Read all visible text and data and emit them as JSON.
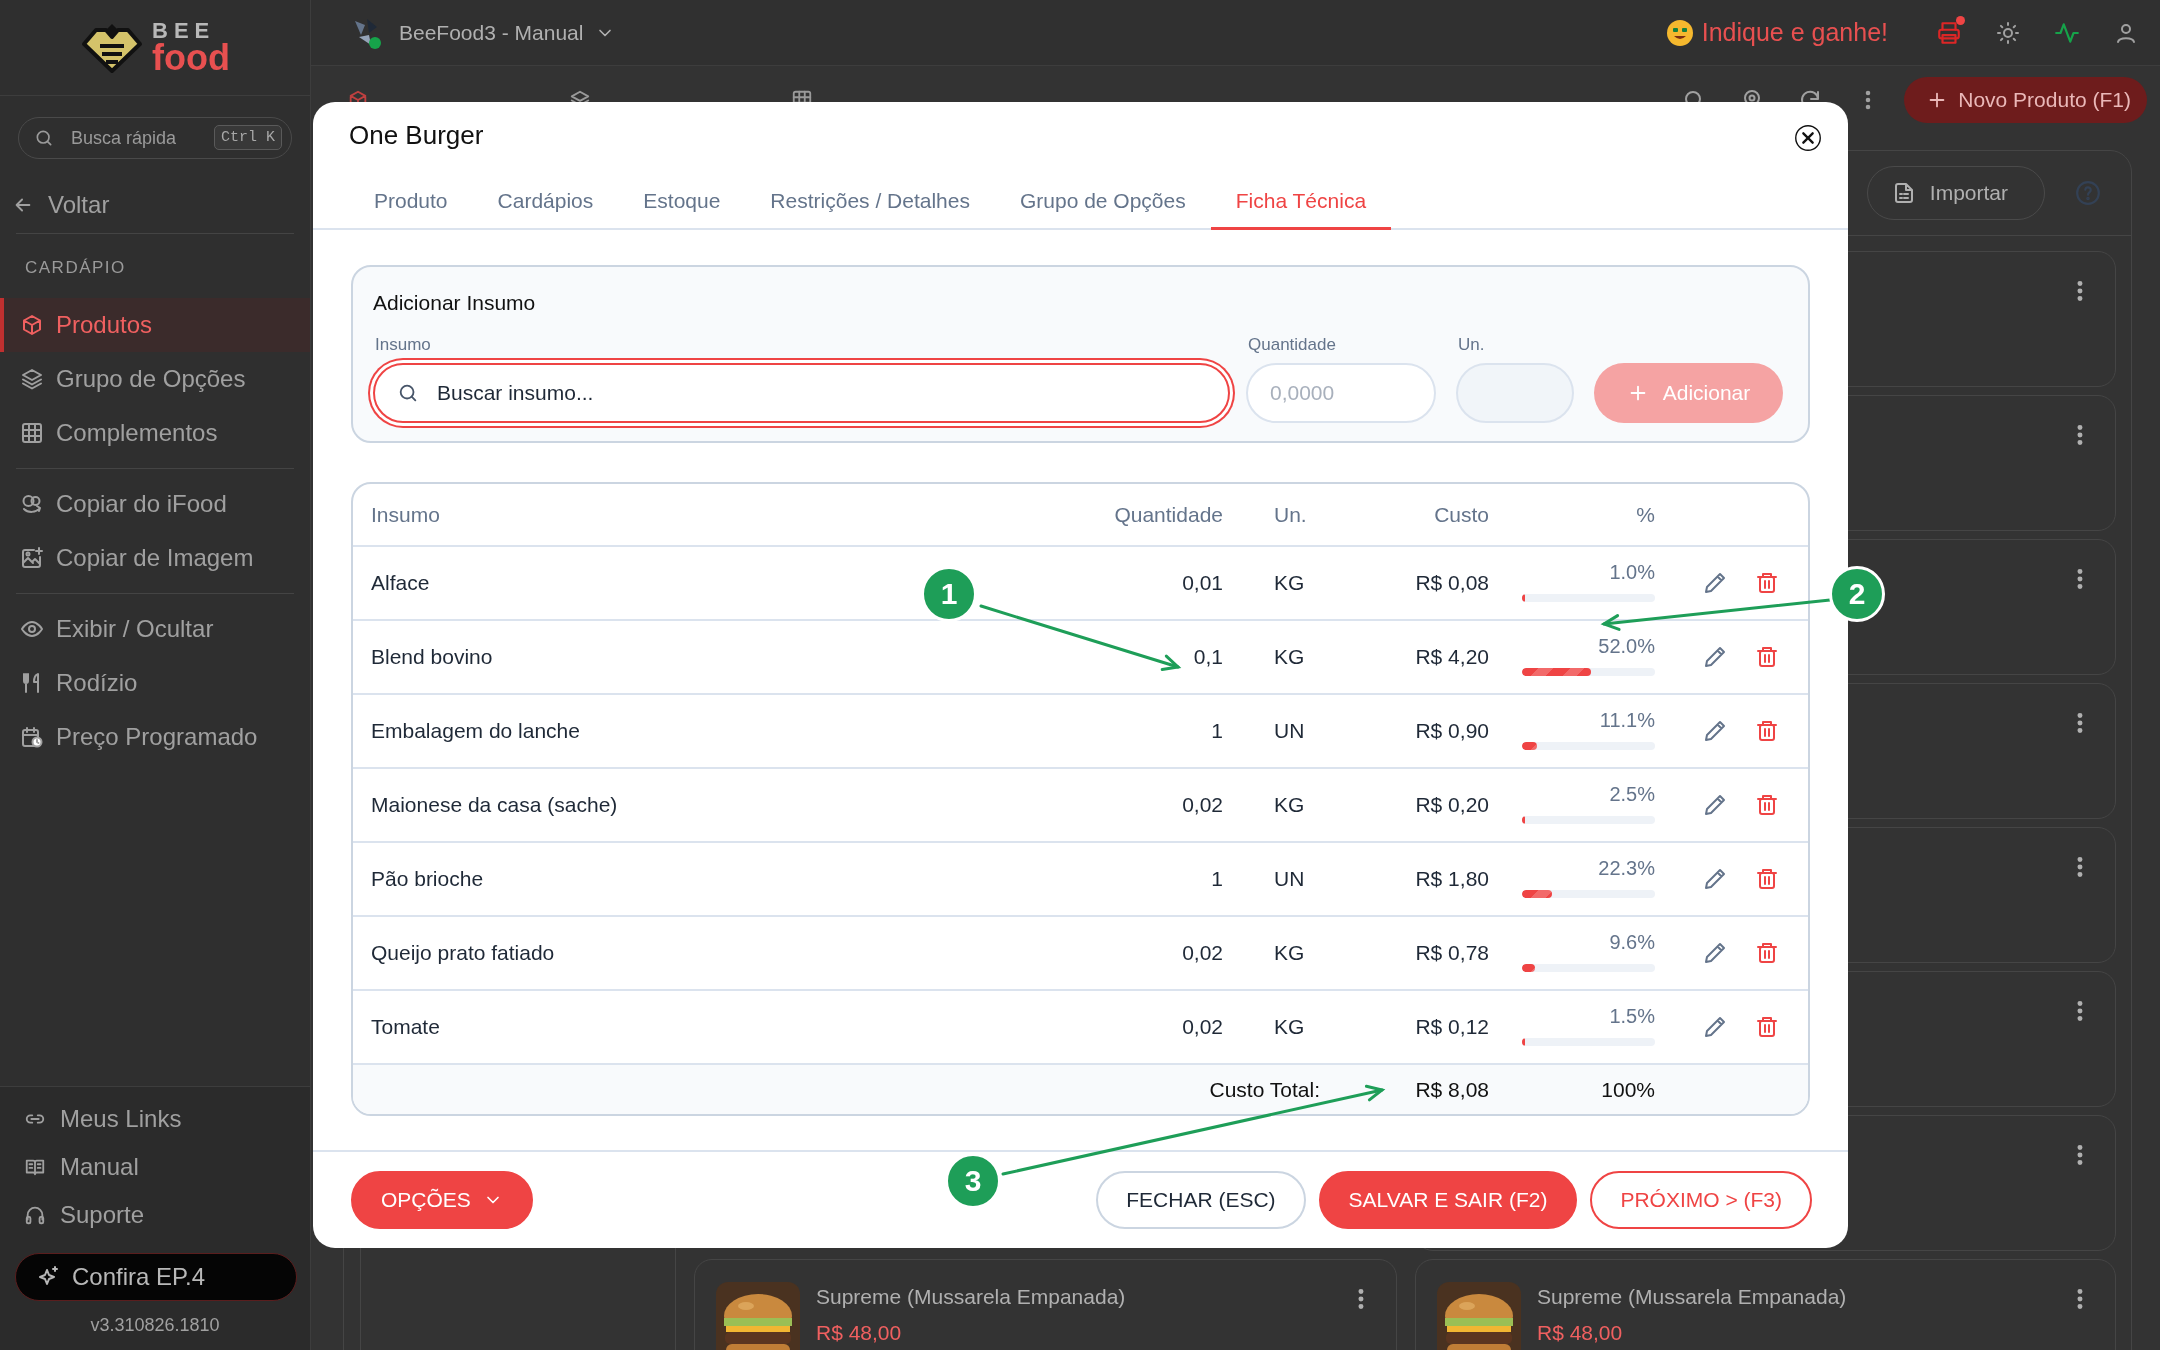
{
  "logo": {
    "line_1": "BEE",
    "line_2": "food"
  },
  "sidebar": {
    "search": {
      "placeholder": "Busca rápida",
      "shortcut": "Ctrl K"
    },
    "back": "Voltar",
    "section": "CARDÁPIO",
    "groups": [
      {
        "items": [
          {
            "label": "Produtos",
            "selected": true
          },
          {
            "label": "Grupo de Opções",
            "selected": false
          },
          {
            "label": "Complementos",
            "selected": false
          }
        ]
      },
      {
        "items": [
          {
            "label": "Copiar do iFood",
            "selected": false
          },
          {
            "label": "Copiar de Imagem",
            "selected": false
          }
        ]
      },
      {
        "items": [
          {
            "label": "Exibir / Ocultar",
            "selected": false
          },
          {
            "label": "Rodízio",
            "selected": false
          },
          {
            "label": "Preço Programado",
            "selected": false
          }
        ]
      }
    ],
    "links": [
      "Meus Links",
      "Manual",
      "Suporte"
    ],
    "promo": "Confira EP.4",
    "version": "v3.310826.1810"
  },
  "top_bar": {
    "workspace": "BeeFood3 - Manual",
    "referral": "Indique e ganhe!"
  },
  "page": {
    "new_button": "Novo Produto (F1)",
    "import_button": "Importar",
    "cards": [
      {
        "kind": "covered"
      },
      {
        "kind": "covered"
      },
      {
        "kind": "covered"
      },
      {
        "kind": "covered"
      },
      {
        "kind": "covered"
      },
      {
        "kind": "covered"
      },
      {
        "kind": "covered"
      },
      {
        "kind": "product",
        "name": "Supreme (Mussarela Empanada)",
        "price": "R$ 48,00"
      },
      {
        "kind": "product",
        "name": "Supreme (Mussarela Empanada)",
        "price": "R$ 48,00"
      }
    ]
  },
  "modal": {
    "title": "One Burger",
    "tabs": [
      {
        "label": "Produto",
        "selected": false
      },
      {
        "label": "Cardápios",
        "selected": false
      },
      {
        "label": "Estoque",
        "selected": false
      },
      {
        "label": "Restrições / Detalhes",
        "selected": false
      },
      {
        "label": "Grupo de Opções",
        "selected": false
      },
      {
        "label": "Ficha Técnica",
        "selected": true
      }
    ],
    "add_panel": {
      "title": "Adicionar Insumo",
      "insumo_label": "Insumo",
      "search_placeholder": "Buscar insumo...",
      "search_focused": true,
      "quantity_label": "Quantidade",
      "quantity_placeholder": "0,0000",
      "unit_label": "Un.",
      "add_button": "Adicionar",
      "add_disabled": true
    },
    "table": {
      "columns": [
        "Insumo",
        "Quantidade",
        "Un.",
        "Custo",
        "%"
      ],
      "rows": [
        {
          "name": "Alface",
          "quantity": "0,01",
          "unit": "KG",
          "cost": "R$ 0,08",
          "percent": "1.0%",
          "level": 0.01
        },
        {
          "name": "Blend bovino",
          "quantity": "0,1",
          "unit": "KG",
          "cost": "R$ 4,20",
          "percent": "52.0%",
          "level": 0.52
        },
        {
          "name": "Embalagem do lanche",
          "quantity": "1",
          "unit": "UN",
          "cost": "R$ 0,90",
          "percent": "11.1%",
          "level": 0.111
        },
        {
          "name": "Maionese da casa (sache)",
          "quantity": "0,02",
          "unit": "KG",
          "cost": "R$ 0,20",
          "percent": "2.5%",
          "level": 0.025
        },
        {
          "name": "Pão brioche",
          "quantity": "1",
          "unit": "UN",
          "cost": "R$ 1,80",
          "percent": "22.3%",
          "level": 0.223
        },
        {
          "name": "Queijo prato fatiado",
          "quantity": "0,02",
          "unit": "KG",
          "cost": "R$ 0,78",
          "percent": "9.6%",
          "level": 0.096
        },
        {
          "name": "Tomate",
          "quantity": "0,02",
          "unit": "KG",
          "cost": "R$ 0,12",
          "percent": "1.5%",
          "level": 0.015
        }
      ],
      "total_label": "Custo Total:",
      "total_cost": "R$ 8,08",
      "total_percent": "100%"
    },
    "buttons": {
      "options": "OPÇÕES",
      "close": "FECHAR (ESC)",
      "save": "SALVAR E SAIR (F2)",
      "next": "PRÓXIMO > (F3)"
    }
  },
  "annotations": [
    {
      "label": "1"
    },
    {
      "label": "2"
    },
    {
      "label": "3"
    }
  ]
}
